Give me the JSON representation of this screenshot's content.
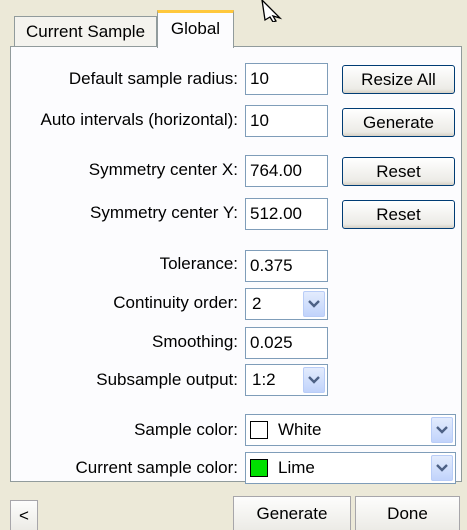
{
  "tabs": [
    "Current Sample",
    "Global"
  ],
  "rows": {
    "default_radius": {
      "label": "Default sample radius:",
      "value": "10",
      "button": "Resize All"
    },
    "auto_intervals": {
      "label": "Auto intervals (horizontal):",
      "value": "10",
      "button": "Generate"
    },
    "sym_x": {
      "label": "Symmetry center X:",
      "value": "764.00",
      "button": "Reset"
    },
    "sym_y": {
      "label": "Symmetry center Y:",
      "value": "512.00",
      "button": "Reset"
    },
    "tolerance": {
      "label": "Tolerance:",
      "value": "0.375"
    },
    "continuity": {
      "label": "Continuity order:",
      "value": "2"
    },
    "smoothing": {
      "label": "Smoothing:",
      "value": "0.025"
    },
    "subsample": {
      "label": "Subsample output:",
      "value": "1:2"
    },
    "sample_color": {
      "label": "Sample color:",
      "value": "White",
      "swatch": "#ffffff"
    },
    "current_color": {
      "label": "Current sample color:",
      "value": "Lime",
      "swatch": "#00e000"
    }
  },
  "footer": {
    "scroll_left": "<",
    "generate": "Generate",
    "done": "Done"
  },
  "icons": {
    "combo_arrow": "chevron-down-icon",
    "cursor": "mouse-pointer-icon"
  }
}
